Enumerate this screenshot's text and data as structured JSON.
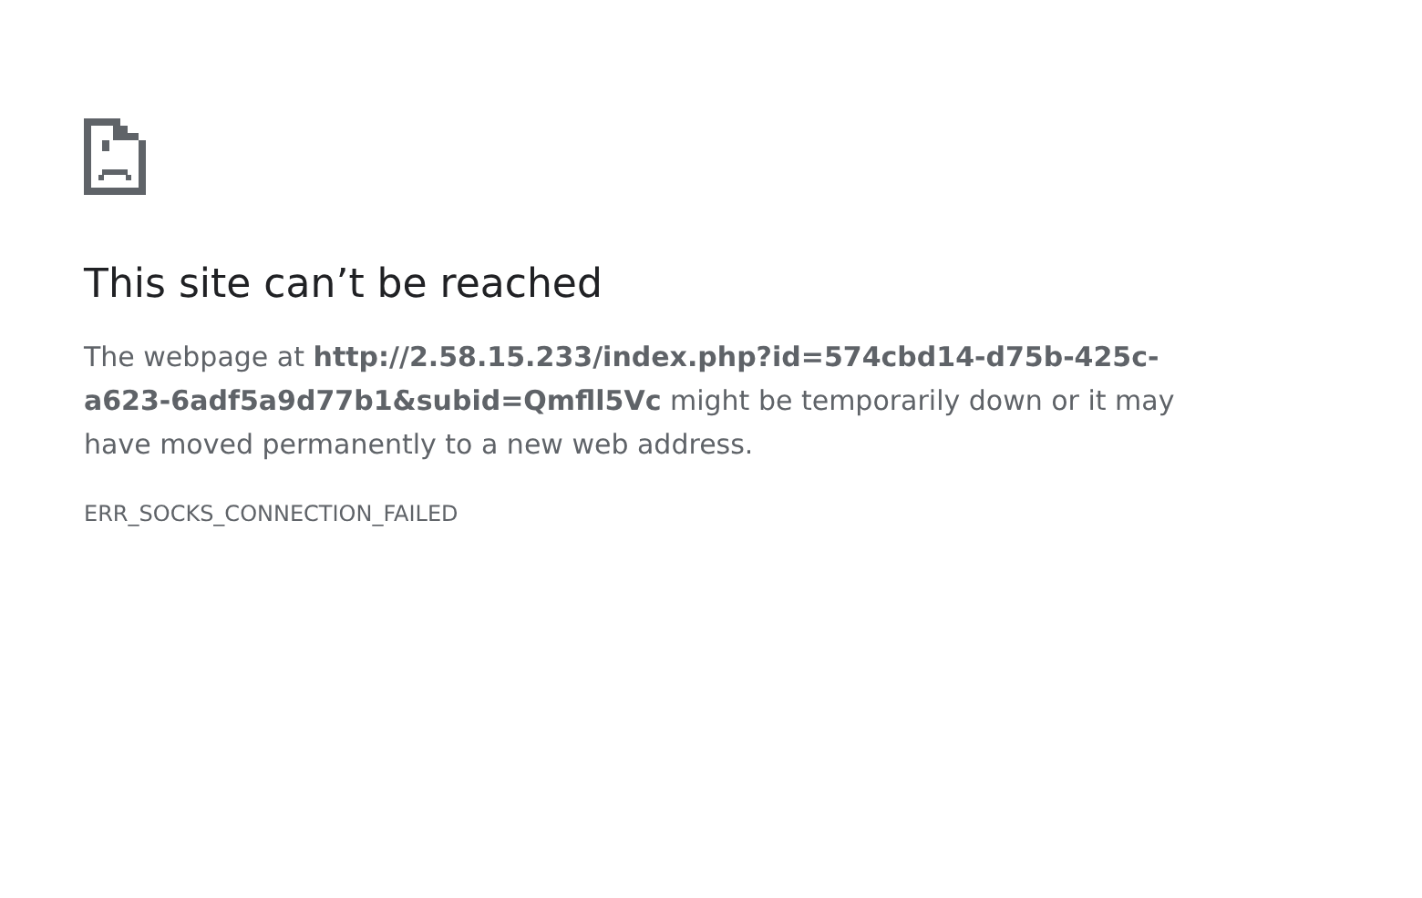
{
  "heading": "This site can’t be reached",
  "message": "The webpage at **http://2.58.15.233/index.php?id=574cbd14-d75b-425c-a623-6adf5a9d77b1&subid=Qmfll5Vc** might be temporarily down or it may have moved permanently to a new web address.",
  "error_code": "ERR_SOCKS_CONNECTION_FAILED"
}
